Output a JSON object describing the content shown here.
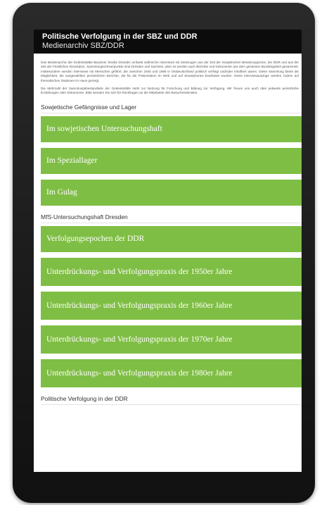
{
  "header": {
    "title": "Politische Verfolgung in der SBZ und DDR",
    "subtitle": "Medienarchiv SBZ/DDR"
  },
  "intro": {
    "paragraph1": "Das Medienarchiv der Gedenkstätte Bautzner Straße Dresden umfasst zahlreiche Interviews mit Zeitzeugen aus der Zeit der Sowjetischen Besatzungszone, der DDR und aus der Zeit der Friedlichen Revolution. Sammlungsschwerpunkte sind Dresden und Sachsen, aber es werden auch Berichte und Dokumente aus dem gesamten Bundesgebiet gesammelt. Insbesondere werden Interviews mit Menschen geführt, die zwischen 1945 und 1989 in Ostdeutschland politisch verfolgt und/oder inhaftiert waren. Diese Sammlung bietet die Möglichkeit, die ausgewählten persönlichen Berichte, die für die Präsentation im Web und auf Smartphones bearbeitet wurden. Diese Interviewauszüge werden zudem auf thematischen Stationen im Haus gezeigt.",
    "paragraph2": "Die Mehrzahl der Sammlungsbestandteile der Gedenkstätte steht zur Nutzung für Forschung und Bildung zur Verfügung. Wir freuen uns auch über jedwede persönliche Erzählungen oder Dokumente. Bitte wenden Sie sich für Rückfragen an die Mitarbeiter des Besucherdienstes."
  },
  "sections": [
    {
      "label": "Sowjetische Gefängnisse und Lager",
      "buttons": [
        "Im sowjetischen Untersuchungshaft",
        "Im Speziallager",
        "Im Gulag"
      ]
    },
    {
      "label": "MfS-Untersuchungshaft Dresden",
      "buttons": [
        "Verfolgungsepochen der DDR",
        "Unterdrückungs- und Verfolgungspraxis der 1950er Jahre",
        "Unterdrückungs- und Verfolgungspraxis der 1960er Jahre",
        "Unterdrückungs- und Verfolgungspraxis der 1970er Jahre",
        "Unterdrückungs- und Verfolgungspraxis der 1980er Jahre"
      ]
    },
    {
      "label": "Politische Verfolgung in der DDR",
      "buttons": []
    }
  ],
  "colors": {
    "button_green": "#7fbe44",
    "titlebar_black": "#0c0c0c",
    "device_frame": "#1b1b1b"
  }
}
